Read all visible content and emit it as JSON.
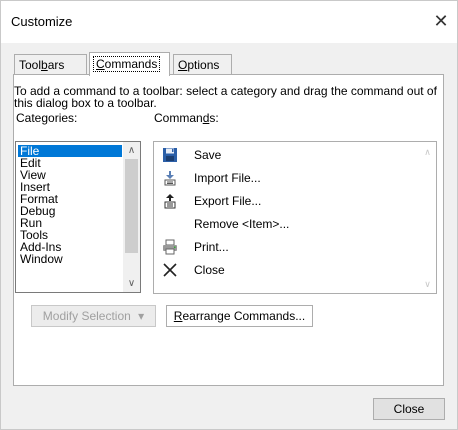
{
  "window": {
    "title": "Customize",
    "close_glyph": "✕"
  },
  "tabs": [
    {
      "label_pre": "Tool",
      "label_u": "b",
      "label_post": "ars"
    },
    {
      "label_u": "C",
      "label_post": "ommands"
    },
    {
      "label_u": "O",
      "label_post": "ptions"
    }
  ],
  "instructions": "To add a command to a toolbar: select a category and drag the command out of this dialog box to a toolbar.",
  "categories_label": {
    "pre": "Cate",
    "u": "g",
    "post": "ories:"
  },
  "commands_label": {
    "pre": "Comman",
    "u": "d",
    "post": "s:"
  },
  "categories": [
    "File",
    "Edit",
    "View",
    "Insert",
    "Format",
    "Debug",
    "Run",
    "Tools",
    "Add-Ins",
    "Window"
  ],
  "selected_category": "File",
  "commands": [
    {
      "label": "Save",
      "icon": "save-icon"
    },
    {
      "label": "Import File...",
      "icon": "import-file-icon"
    },
    {
      "label": "Export File...",
      "icon": "export-file-icon"
    },
    {
      "label": "Remove <Item>...",
      "icon": ""
    },
    {
      "label": "Print...",
      "icon": "print-icon"
    },
    {
      "label": "Close",
      "icon": "close-icon"
    }
  ],
  "buttons": {
    "modify_selection": "Modify Selection",
    "modify_selection_arrow": "▾",
    "rearrange": {
      "u": "R",
      "post": "earrange Commands..."
    },
    "close": "Close"
  },
  "scroll": {
    "up_glyph": "∧",
    "down_glyph": "∨"
  },
  "colors": {
    "selection": "#0078d7",
    "dialog_bg": "#f0f0f0"
  }
}
